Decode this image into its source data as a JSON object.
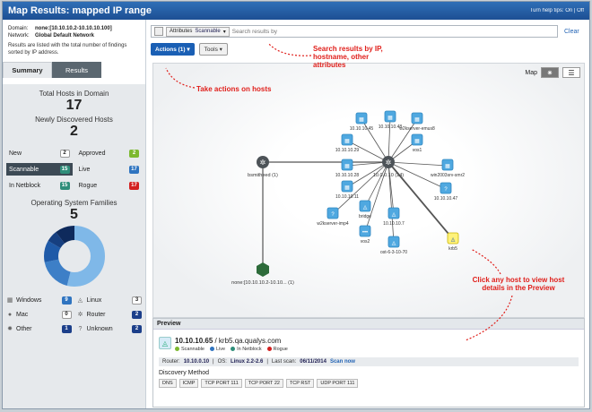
{
  "title": "Map Results: mapped IP range",
  "help_tips": "Turn help tips: On | Off",
  "domain_label": "Domain:",
  "domain_value": "none:[10.10.10.2-10.10.10.100]",
  "network_label": "Network:",
  "network_value": "Global Default Network",
  "info_note": "Results are listed with the total number of findings sorted by IP address.",
  "tabs": [
    "Summary",
    "Results"
  ],
  "total_hosts_label": "Total Hosts in Domain",
  "total_hosts": "17",
  "new_hosts_label": "Newly Discovered Hosts",
  "new_hosts": "2",
  "stats": [
    {
      "label": "New",
      "count": "2",
      "style": "b-white"
    },
    {
      "label": "Approved",
      "count": "2",
      "style": "b-green"
    },
    {
      "label": "Scannable",
      "count": "15",
      "style": "b-teal",
      "selected": true
    },
    {
      "label": "Live",
      "count": "17",
      "style": "b-blue"
    },
    {
      "label": "In Netblock",
      "count": "15",
      "style": "b-teal"
    },
    {
      "label": "Rogue",
      "count": "17",
      "style": "b-red"
    }
  ],
  "os_title": "Operating System Families",
  "os_count": "5",
  "os": [
    {
      "label": "Windows",
      "count": "9",
      "style": "b-blue",
      "icon": "windows-icon",
      "glyph": "▦"
    },
    {
      "label": "Linux",
      "count": "3",
      "style": "b-white",
      "icon": "linux-icon",
      "glyph": "◬"
    },
    {
      "label": "Mac",
      "count": "0",
      "style": "b-white",
      "icon": "apple-icon",
      "glyph": "●"
    },
    {
      "label": "Router",
      "count": "2",
      "style": "b-navy",
      "icon": "router-icon",
      "glyph": "✲"
    },
    {
      "label": "Other",
      "count": "1",
      "style": "b-navy",
      "icon": "gear-icon",
      "glyph": "✹"
    },
    {
      "label": "Unknown",
      "count": "2",
      "style": "b-navy",
      "icon": "question-icon",
      "glyph": "?"
    }
  ],
  "attributes_label": "Attributes",
  "attributes_value": "Scannable",
  "search_placeholder": "Search results by",
  "clear": "Clear",
  "actions_btn": "Actions (1) ▾",
  "tools_btn": "Tools ▾",
  "map_label": "Map",
  "annotations": {
    "search": "Search results by IP, hostname, other attributes",
    "actions": "Take actions on hosts",
    "host": "Click any host to view host details in the Preview"
  },
  "map_nodes": [
    {
      "label": "10.10.10.45",
      "kind": "win"
    },
    {
      "label": "10.10.10.48",
      "kind": "win"
    },
    {
      "label": "w2kserver-emus8",
      "kind": "win"
    },
    {
      "label": "10.10.10.29",
      "kind": "win"
    },
    {
      "label": "vos1",
      "kind": "win"
    },
    {
      "label": "10.10.10.28",
      "kind": "win"
    },
    {
      "label": "win2003srv-smr2",
      "kind": "win"
    },
    {
      "label": "10.10.10.11",
      "kind": "win"
    },
    {
      "label": "10.10.10.47",
      "kind": "unk"
    },
    {
      "label": "w2kserver-imp4",
      "kind": "unk"
    },
    {
      "label": "bridge",
      "kind": "linux"
    },
    {
      "label": "10.10.10.7",
      "kind": "linux"
    },
    {
      "label": "vos2",
      "kind": "other"
    },
    {
      "label": "ost-6-3-10-70",
      "kind": "linux"
    },
    {
      "label": "krb5",
      "kind": "sel"
    }
  ],
  "routers": [
    {
      "label": "bsmitheed (1)"
    },
    {
      "label": "10.0.0.10 (14)"
    },
    {
      "label": "none:[10.10.10.2-10.10... (1)"
    }
  ],
  "preview": {
    "header": "Preview",
    "host_ip": "10.10.10.65",
    "host_name": " / krb5.qa.qualys.com",
    "status": [
      "Scannable",
      "Live",
      "In Netblock",
      "Rogue"
    ],
    "status_colors": [
      "#7cb82f",
      "#2f74c0",
      "#2f8e7a",
      "#d32020"
    ],
    "router_label": "Router:",
    "router_value": "10.10.0.10",
    "os_label": "OS:",
    "os_value": "Linux 2.2-2.6",
    "last_scan_label": "Last scan:",
    "last_scan_value": "06/11/2014",
    "scan_now": "Scan now",
    "discovery_label": "Discovery Method",
    "methods": [
      "DNS",
      "ICMP",
      "TCP PORT 111",
      "TCP PORT 22",
      "TCP RST",
      "UDP PORT 111"
    ]
  }
}
